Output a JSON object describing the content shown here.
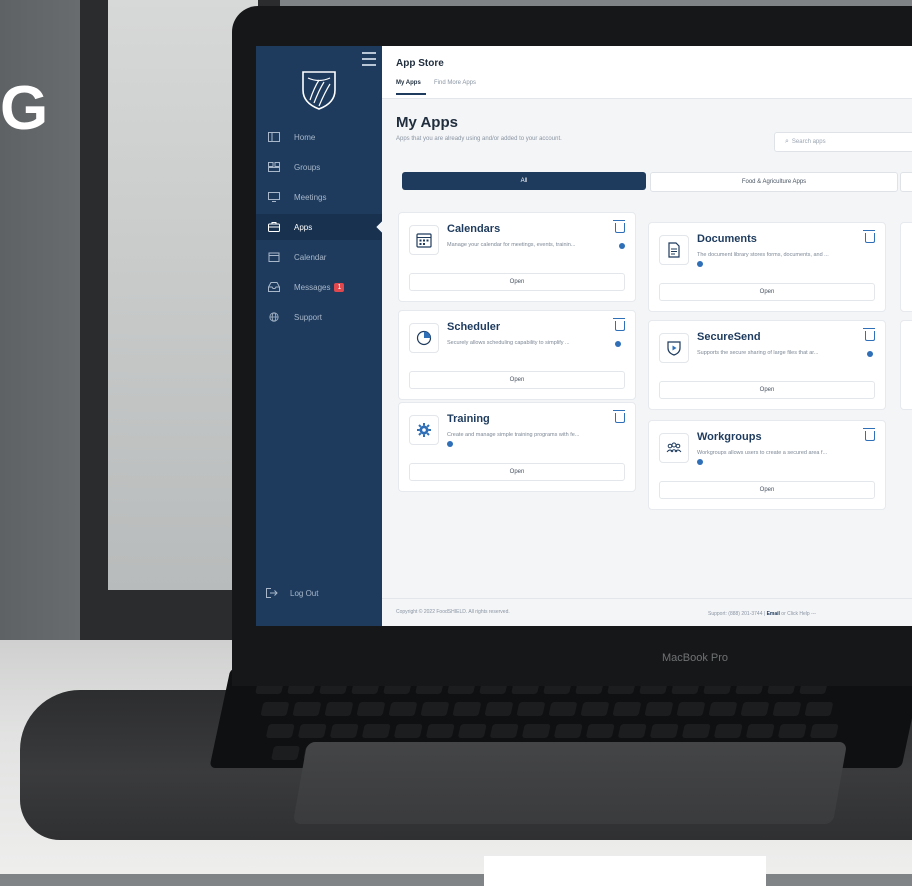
{
  "backdrop": {
    "letter": "G"
  },
  "device": {
    "brand": "MacBook Pro"
  },
  "sidebar": {
    "items": [
      {
        "label": "Home",
        "icon": "layout-icon"
      },
      {
        "label": "Groups",
        "icon": "groups-icon"
      },
      {
        "label": "Meetings",
        "icon": "monitor-icon"
      },
      {
        "label": "Apps",
        "icon": "apps-icon",
        "active": true
      },
      {
        "label": "Calendar",
        "icon": "calendar-icon"
      },
      {
        "label": "Messages",
        "icon": "inbox-icon",
        "badge": "1"
      },
      {
        "label": "Support",
        "icon": "globe-icon"
      }
    ],
    "logout_label": "Log Out"
  },
  "header": {
    "title": "App Store",
    "tabs": [
      {
        "label": "My Apps",
        "active": true
      },
      {
        "label": "Find More Apps",
        "active": false
      }
    ]
  },
  "main": {
    "title": "My Apps",
    "subtitle": "Apps that you are already using and/or added to your account.",
    "search_placeholder": "Search apps",
    "filters": [
      {
        "label": "All",
        "active": true
      },
      {
        "label": "Food & Agriculture Apps",
        "active": false
      }
    ],
    "apps": [
      {
        "name": "Calendars",
        "description": "Manage your calendar for meetings, events, trainin...",
        "open_label": "Open",
        "icon": "calendar-grid-icon"
      },
      {
        "name": "Documents",
        "description": "The document library stores forms, documents, and ...",
        "open_label": "Open",
        "icon": "document-icon"
      },
      {
        "name": "Scheduler",
        "description": "Securely allows scheduling capability to simplify ...",
        "open_label": "Open",
        "icon": "pie-clock-icon"
      },
      {
        "name": "SecureSend",
        "description": "Supports the secure sharing of large files that ar...",
        "open_label": "Open",
        "icon": "shield-play-icon"
      },
      {
        "name": "Training",
        "description": "Create and manage simple training programs with fe...",
        "open_label": "Open",
        "icon": "gear-icon"
      },
      {
        "name": "Workgroups",
        "description": "Workgroups allows users to create a secured area f...",
        "open_label": "Open",
        "icon": "people-icon"
      }
    ]
  },
  "footer": {
    "copyright": "Copyright © 2022 FoodSHIELD. All rights reserved.",
    "support_prefix": "Support: (888) 201-3744 |",
    "support_email": "Email",
    "support_suffix": "or Click Help ---"
  },
  "colors": {
    "sidebar": "#1e3b5e",
    "accent": "#2f6fb8",
    "badge": "#e0484d"
  }
}
